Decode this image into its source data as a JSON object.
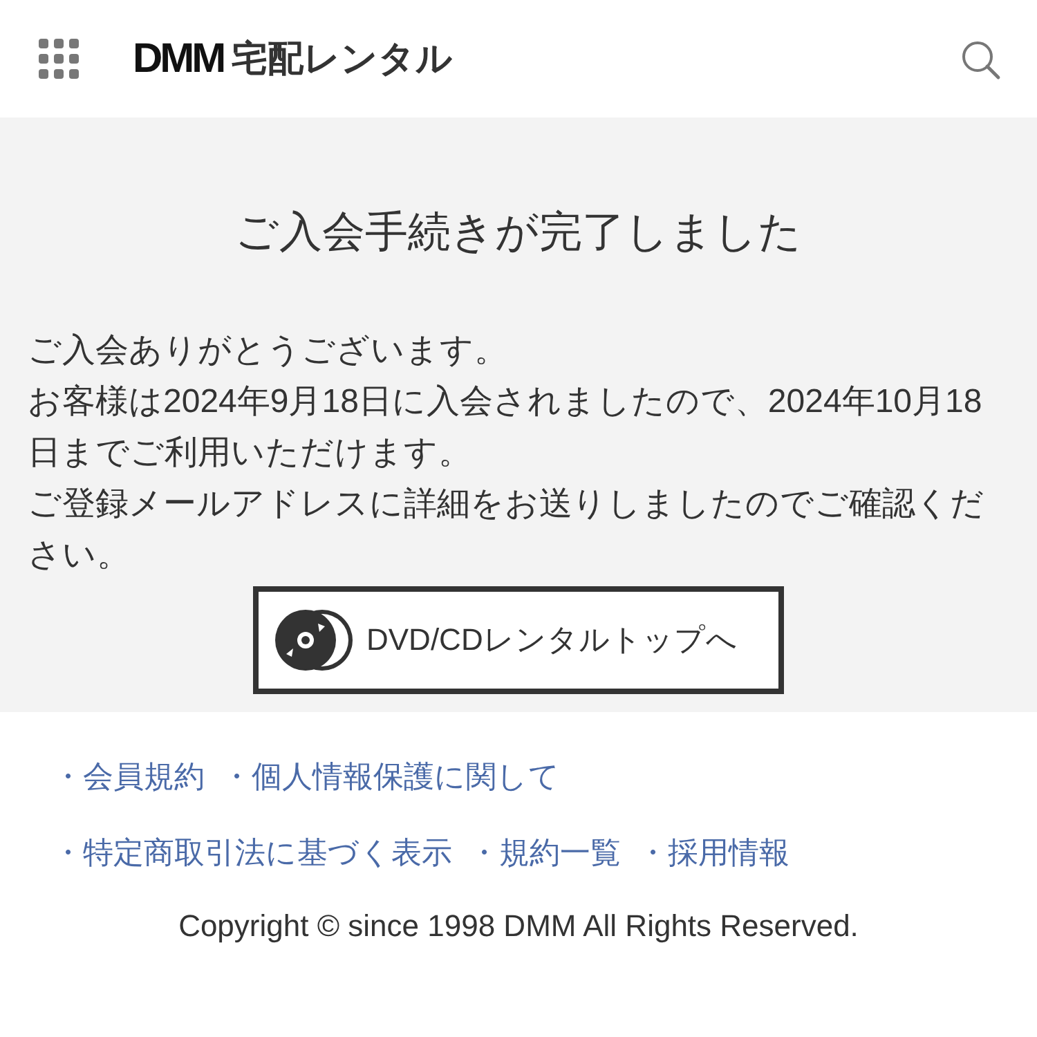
{
  "header": {
    "logo_mark": "DMM",
    "logo_text": "宅配レンタル"
  },
  "main": {
    "title": "ご入会手続きが完了しました",
    "paragraphs": [
      "ご入会ありがとうございます。",
      "お客様は2024年9月18日に入会されましたので、2024年10月18日までご利用いただけます。",
      "ご登録メールアドレスに詳細をお送りしましたのでご確認ください。"
    ],
    "button": "DVD/CDレンタルトップへ"
  },
  "footer": {
    "link_rows": [
      [
        "・会員規約",
        "・個人情報保護に関して"
      ],
      [
        "・特定商取引法に基づく表示",
        "・規約一覧",
        "・採用情報"
      ]
    ],
    "copyright": "Copyright © since 1998 DMM All Rights Reserved."
  }
}
